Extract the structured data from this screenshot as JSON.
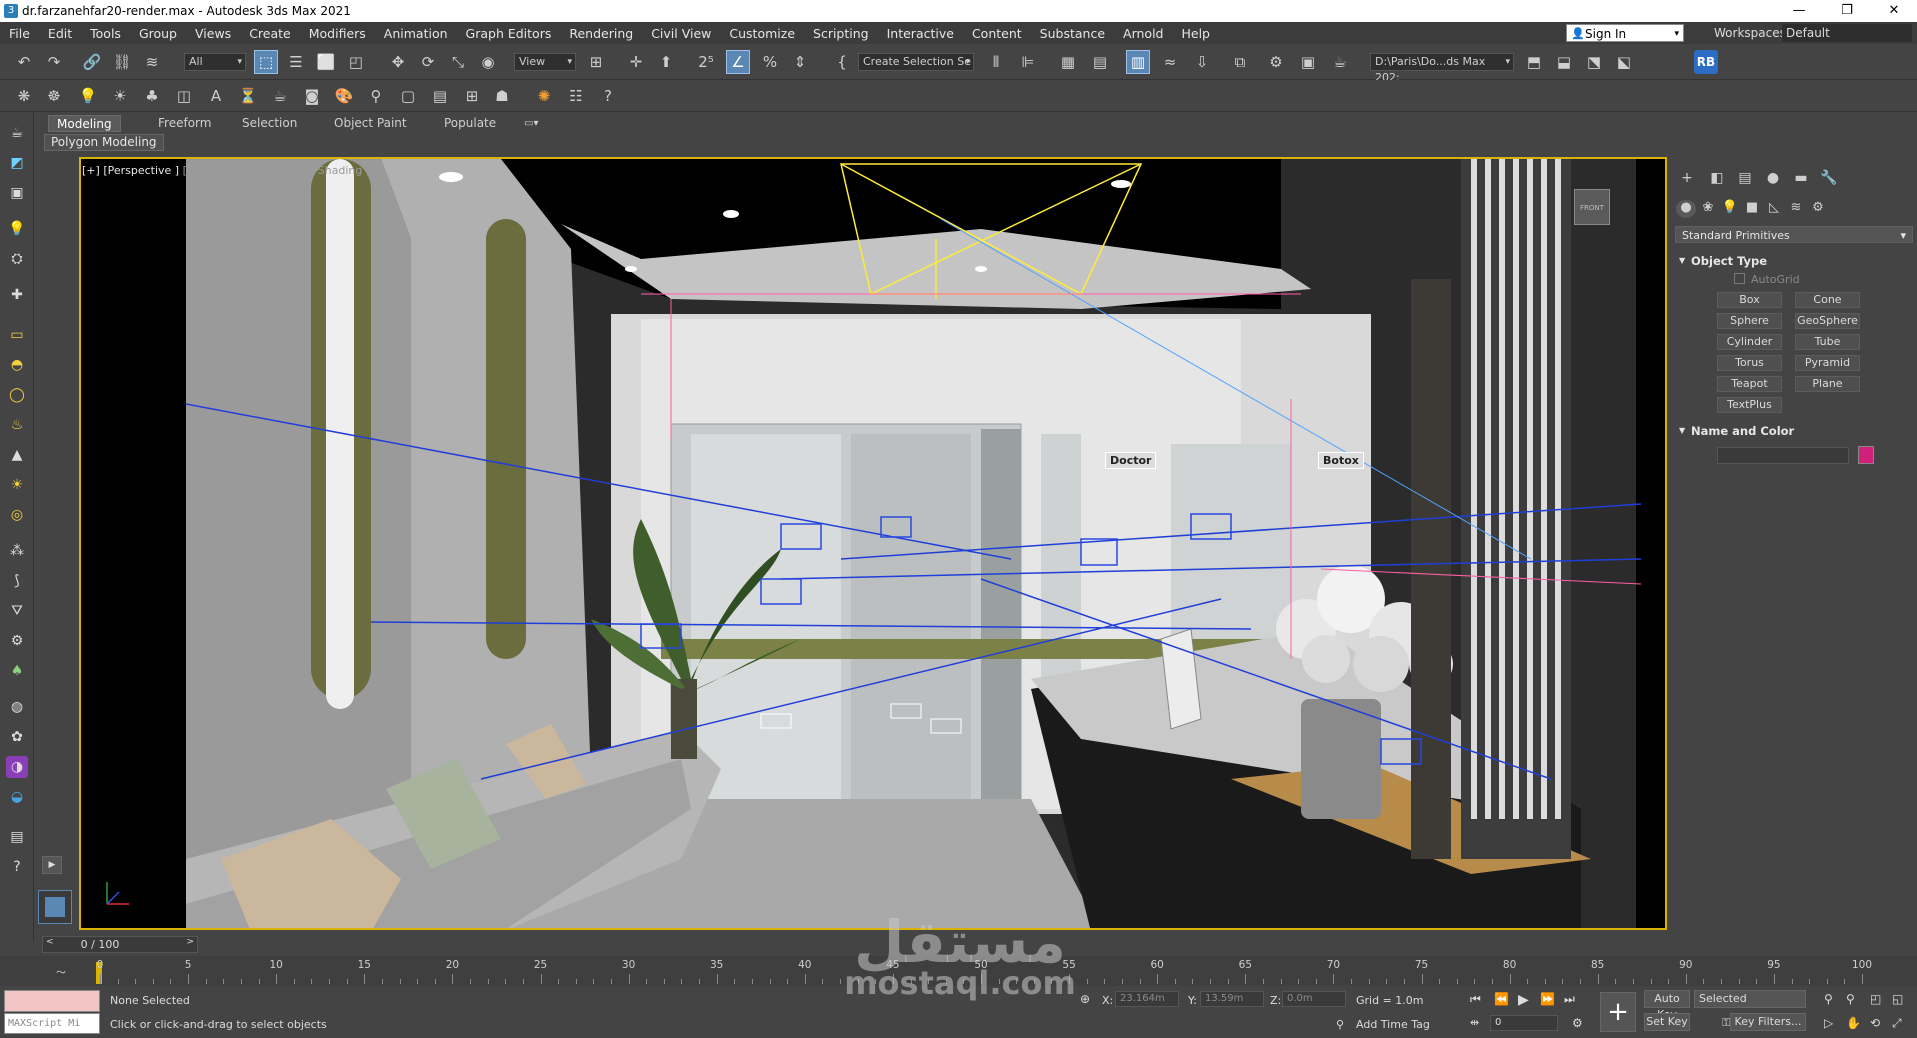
{
  "window": {
    "title": "dr.farzanehfar20-render.max - Autodesk 3ds Max 2021",
    "minimize": "—",
    "maximize": "❐",
    "close": "✕"
  },
  "menu": {
    "items": [
      "File",
      "Edit",
      "Tools",
      "Group",
      "Views",
      "Create",
      "Modifiers",
      "Animation",
      "Graph Editors",
      "Rendering",
      "Civil View",
      "Customize",
      "Scripting",
      "Interactive",
      "Content",
      "Substance",
      "Arnold",
      "Help"
    ],
    "sign_in": "Sign In",
    "workspaces_label": "Workspaces:",
    "workspaces_value": "Default"
  },
  "toolbar": {
    "selection_filter": "All",
    "ref_coord": "View",
    "selection_set": "Create Selection Se",
    "project_path": "D:\\Paris\\Do...ds Max 202:",
    "user_badge": "RB"
  },
  "ribbon": {
    "tabs": [
      "Modeling",
      "Freeform",
      "Selection",
      "Object Paint",
      "Populate"
    ],
    "active_tab": "Modeling",
    "sub_label": "Polygon Modeling"
  },
  "viewport": {
    "label_plus": "[+]",
    "label_view": "[Perspective ]",
    "label_user": "[User Defined ]",
    "label_shading": "[Default Shading ]",
    "tag_doctor": "Doctor",
    "tag_botox": "Botox"
  },
  "command_panel": {
    "category": "Standard Primitives",
    "object_type_title": "Object Type",
    "autogrid": "AutoGrid",
    "buttons": [
      "Box",
      "Cone",
      "Sphere",
      "GeoSphere",
      "Cylinder",
      "Tube",
      "Torus",
      "Pyramid",
      "Teapot",
      "Plane",
      "TextPlus"
    ],
    "name_color_title": "Name and Color",
    "object_color": "#d11f7c"
  },
  "timeline": {
    "slider_value": "0 / 100",
    "frame_labels": [
      "0",
      "5",
      "10",
      "15",
      "20",
      "25",
      "30",
      "35",
      "40",
      "45",
      "50",
      "55",
      "60",
      "65",
      "70",
      "75",
      "80",
      "85",
      "90",
      "95",
      "100"
    ]
  },
  "status": {
    "maxscript": "MAXScript Mi",
    "selection": "None Selected",
    "prompt": "Click or click-and-drag to select objects",
    "x_label": "X:",
    "x_value": "23.164m",
    "y_label": "Y:",
    "y_value": "13.59m",
    "z_label": "Z:",
    "z_value": "0.0m",
    "grid": "Grid = 1.0m",
    "add_time_tag": "Add Time Tag",
    "auto_key": "Auto Key",
    "set_key": "Set Key",
    "key_mode": "Selected",
    "key_filters": "Key Filters...",
    "frame": "0"
  },
  "watermark": {
    "arabic": "مستقل",
    "latin": "mostaql.com"
  }
}
